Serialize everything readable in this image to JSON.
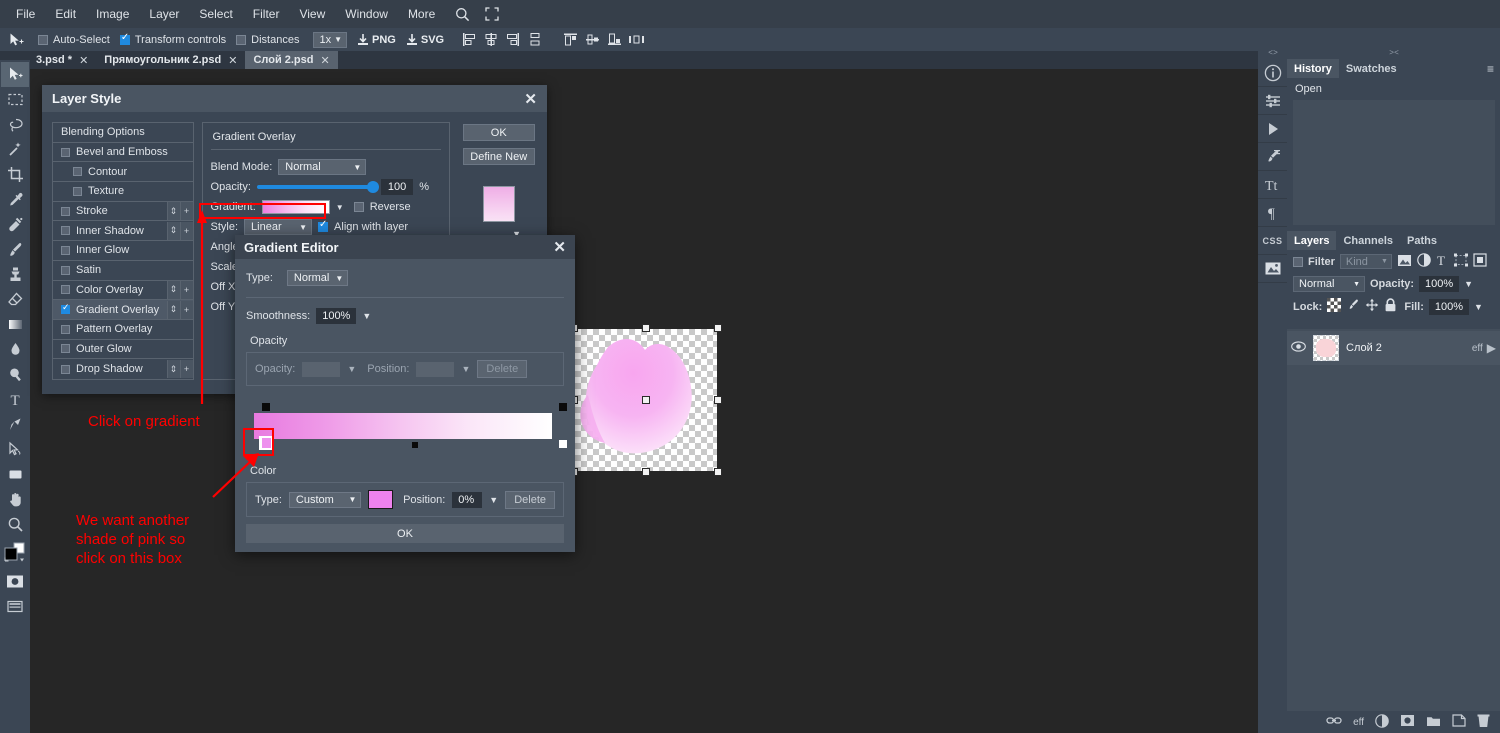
{
  "menubar": {
    "items": [
      "File",
      "Edit",
      "Image",
      "Layer",
      "Select",
      "Filter",
      "View",
      "Window",
      "More"
    ],
    "icons": [
      "search-icon",
      "fullscreen-icon"
    ]
  },
  "options_bar": {
    "tool_icon": "move-tool-icon",
    "checkboxes": [
      {
        "label": "Auto-Select",
        "checked": false
      },
      {
        "label": "Transform controls",
        "checked": true
      },
      {
        "label": "Distances",
        "checked": false
      }
    ],
    "zoom": "1x",
    "export_buttons": [
      {
        "label": "PNG",
        "icon": "download-icon"
      },
      {
        "label": "SVG",
        "icon": "download-icon"
      }
    ],
    "align_icons": [
      "align-left-icon",
      "align-center-h-icon",
      "align-right-icon",
      "distribute-v-icon",
      "align-top-icon",
      "align-middle-icon",
      "align-bottom-icon",
      "distribute-h-icon"
    ]
  },
  "tabs": [
    {
      "label": "3.psd *",
      "active": false
    },
    {
      "label": "Прямоугольник 2.psd",
      "active": false
    },
    {
      "label": "Слой 2.psd",
      "active": true
    }
  ],
  "toolbox": {
    "tools": [
      "move-tool-icon",
      "marquee-tool-icon",
      "lasso-tool-icon",
      "magic-wand-tool-icon",
      "crop-tool-icon",
      "eyedropper-tool-icon",
      "healing-brush-tool-icon",
      "brush-tool-icon",
      "clone-stamp-tool-icon",
      "eraser-tool-icon",
      "gradient-tool-icon",
      "blur-tool-icon",
      "dodge-tool-icon",
      "type-tool-icon",
      "pen-tool-icon",
      "path-select-tool-icon",
      "shape-tool-icon",
      "hand-tool-icon",
      "zoom-tool-icon",
      "foreground-background-color-icon",
      "quick-mask-icon",
      "screen-mode-icon"
    ]
  },
  "layer_style": {
    "title": "Layer Style",
    "close": "✕",
    "effects": [
      {
        "label": "Blending Options",
        "checkbox": false,
        "checked": false,
        "indent": false,
        "selected": false,
        "buttons": false
      },
      {
        "label": "Bevel and Emboss",
        "checkbox": true,
        "checked": false,
        "indent": false,
        "selected": false,
        "buttons": false
      },
      {
        "label": "Contour",
        "checkbox": true,
        "checked": false,
        "indent": true,
        "selected": false,
        "buttons": false
      },
      {
        "label": "Texture",
        "checkbox": true,
        "checked": false,
        "indent": true,
        "selected": false,
        "buttons": false
      },
      {
        "label": "Stroke",
        "checkbox": true,
        "checked": false,
        "indent": false,
        "selected": false,
        "buttons": true
      },
      {
        "label": "Inner Shadow",
        "checkbox": true,
        "checked": false,
        "indent": false,
        "selected": false,
        "buttons": true
      },
      {
        "label": "Inner Glow",
        "checkbox": true,
        "checked": false,
        "indent": false,
        "selected": false,
        "buttons": false
      },
      {
        "label": "Satin",
        "checkbox": true,
        "checked": false,
        "indent": false,
        "selected": false,
        "buttons": false
      },
      {
        "label": "Color Overlay",
        "checkbox": true,
        "checked": false,
        "indent": false,
        "selected": false,
        "buttons": true
      },
      {
        "label": "Gradient Overlay",
        "checkbox": true,
        "checked": true,
        "indent": false,
        "selected": true,
        "buttons": true
      },
      {
        "label": "Pattern Overlay",
        "checkbox": true,
        "checked": false,
        "indent": false,
        "selected": false,
        "buttons": false
      },
      {
        "label": "Outer Glow",
        "checkbox": true,
        "checked": false,
        "indent": false,
        "selected": false,
        "buttons": false
      },
      {
        "label": "Drop Shadow",
        "checkbox": true,
        "checked": false,
        "indent": false,
        "selected": false,
        "buttons": true
      }
    ],
    "panel_title": "Gradient Overlay",
    "blend_mode_label": "Blend Mode:",
    "blend_mode_value": "Normal",
    "opacity_label": "Opacity:",
    "opacity_value": "100",
    "opacity_unit": "%",
    "gradient_label": "Gradient:",
    "reverse_label": "Reverse",
    "reverse_checked": false,
    "style_label": "Style:",
    "style_value": "Linear",
    "align_label": "Align with layer",
    "align_checked": true,
    "angle_label": "Angle:",
    "scale_label": "Scale:",
    "offx_label": "Off X:",
    "offy_label": "Off Y:",
    "ok_label": "OK",
    "define_new_label": "Define New",
    "swatch_color": "#efaee6"
  },
  "gradient_editor": {
    "title": "Gradient Editor",
    "close": "✕",
    "type_label": "Type:",
    "type_value": "Normal",
    "smoothness_label": "Smoothness:",
    "smoothness_value": "100%",
    "opacity_section": "Opacity",
    "opacity_label": "Opacity:",
    "position_label": "Position:",
    "delete_label": "Delete",
    "color_section": "Color",
    "color_type_label": "Type:",
    "color_type_value": "Custom",
    "color_swatch": "#ee82ee",
    "color_position_label": "Position:",
    "color_position_value": "0%",
    "color_delete_label": "Delete",
    "ok_label": "OK",
    "stops": {
      "start_color": "#ee82ee",
      "end_color": "#ffffff"
    }
  },
  "annotations": [
    {
      "text": "Click on gradient",
      "color": "#ff0000"
    },
    {
      "text": "We want another",
      "color": "#ff0000"
    },
    {
      "text": "shade of pink so",
      "color": "#ff0000"
    },
    {
      "text": "click on this box",
      "color": "#ff0000"
    }
  ],
  "right_rail": {
    "icons": [
      "info-icon",
      "adjustments-icon",
      "play-icon",
      "brush-presets-icon",
      "character-icon",
      "paragraph-icon",
      "css-icon",
      "image-icon"
    ]
  },
  "history_panel": {
    "tabs": [
      {
        "label": "History",
        "active": true
      },
      {
        "label": "Swatches",
        "active": false
      }
    ],
    "menu_icon": "hamburger-icon",
    "entries": [
      "Open"
    ]
  },
  "layers_panel": {
    "tabs": [
      {
        "label": "Layers",
        "active": true
      },
      {
        "label": "Channels",
        "active": false
      },
      {
        "label": "Paths",
        "active": false
      }
    ],
    "filter_label": "Filter",
    "filter_checked": false,
    "kind_value": "Kind",
    "filter_icons": [
      "image-filter-icon",
      "adjustment-filter-icon",
      "type-filter-icon",
      "shape-filter-icon",
      "smart-object-filter-icon"
    ],
    "blend_mode": "Normal",
    "opacity_label": "Opacity:",
    "opacity_value": "100%",
    "lock_label": "Lock:",
    "lock_icons": [
      "lock-transparency-icon",
      "lock-image-icon",
      "lock-position-icon",
      "lock-all-icon"
    ],
    "fill_label": "Fill:",
    "fill_value": "100%",
    "layers": [
      {
        "name": "Слой 2",
        "visible": true,
        "effects_badge": "eff"
      }
    ],
    "bottom_icons": [
      "link-layers-icon",
      "layer-effects-icon",
      "adjustment-layer-icon",
      "layer-mask-icon",
      "new-group-icon",
      "new-layer-icon",
      "delete-layer-icon"
    ],
    "bottom_eff_label": "eff"
  }
}
